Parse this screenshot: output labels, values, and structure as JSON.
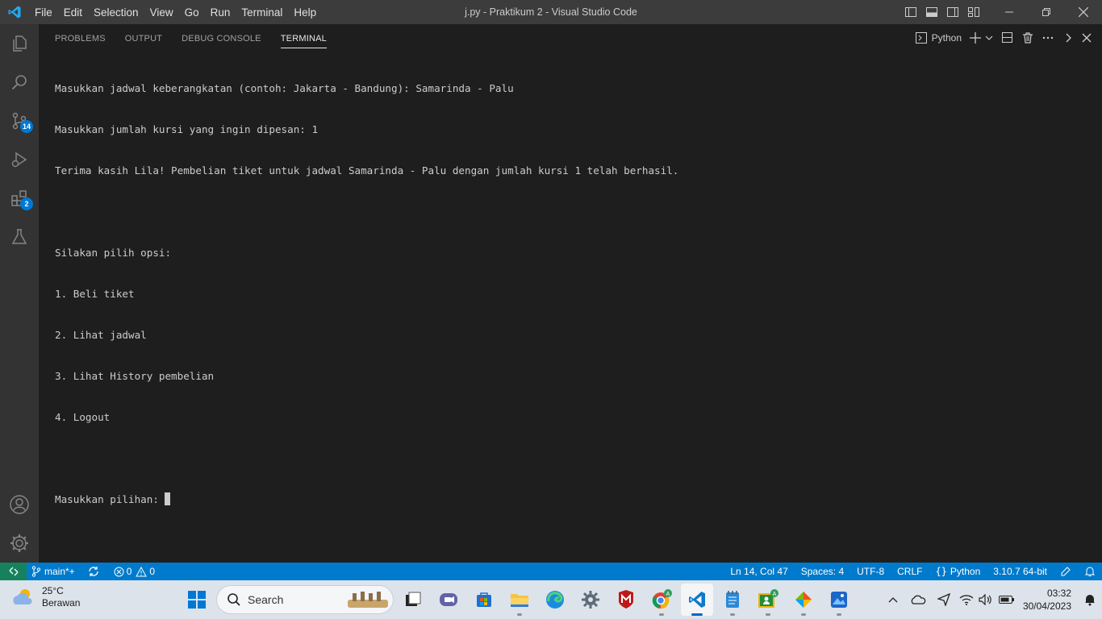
{
  "window": {
    "title": "j.py - Praktikum 2 - Visual Studio Code",
    "menu": [
      "File",
      "Edit",
      "Selection",
      "View",
      "Go",
      "Run",
      "Terminal",
      "Help"
    ]
  },
  "activity_bar": {
    "source_control_badge": "14",
    "extensions_badge": "2"
  },
  "panel": {
    "tabs": [
      "PROBLEMS",
      "OUTPUT",
      "DEBUG CONSOLE",
      "TERMINAL"
    ],
    "active_tab": "TERMINAL",
    "terminal_profile": "Python"
  },
  "terminal": {
    "lines": [
      "Masukkan jadwal keberangkatan (contoh: Jakarta - Bandung): Samarinda - Palu",
      "Masukkan jumlah kursi yang ingin dipesan: 1",
      "Terima kasih Lila! Pembelian tiket untuk jadwal Samarinda - Palu dengan jumlah kursi 1 telah berhasil.",
      "",
      "Silakan pilih opsi:",
      "1. Beli tiket",
      "2. Lihat jadwal",
      "3. Lihat History pembelian",
      "4. Logout",
      ""
    ],
    "prompt": "Masukkan pilihan: "
  },
  "status_bar": {
    "branch": "main*+",
    "errors": "0",
    "warnings": "0",
    "position": "Ln 14, Col 47",
    "spaces": "Spaces: 4",
    "encoding": "UTF-8",
    "eol": "CRLF",
    "language": "Python",
    "interpreter": "3.10.7 64-bit"
  },
  "taskbar": {
    "temperature": "25°C",
    "weather": "Berawan",
    "search_placeholder": "Search",
    "time": "03:32",
    "date": "30/04/2023"
  },
  "colors": {
    "status_bar": "#007acc",
    "remote_indicator": "#16825d",
    "badge": "#0078d4",
    "terminal_bg": "#1e1e1e"
  }
}
